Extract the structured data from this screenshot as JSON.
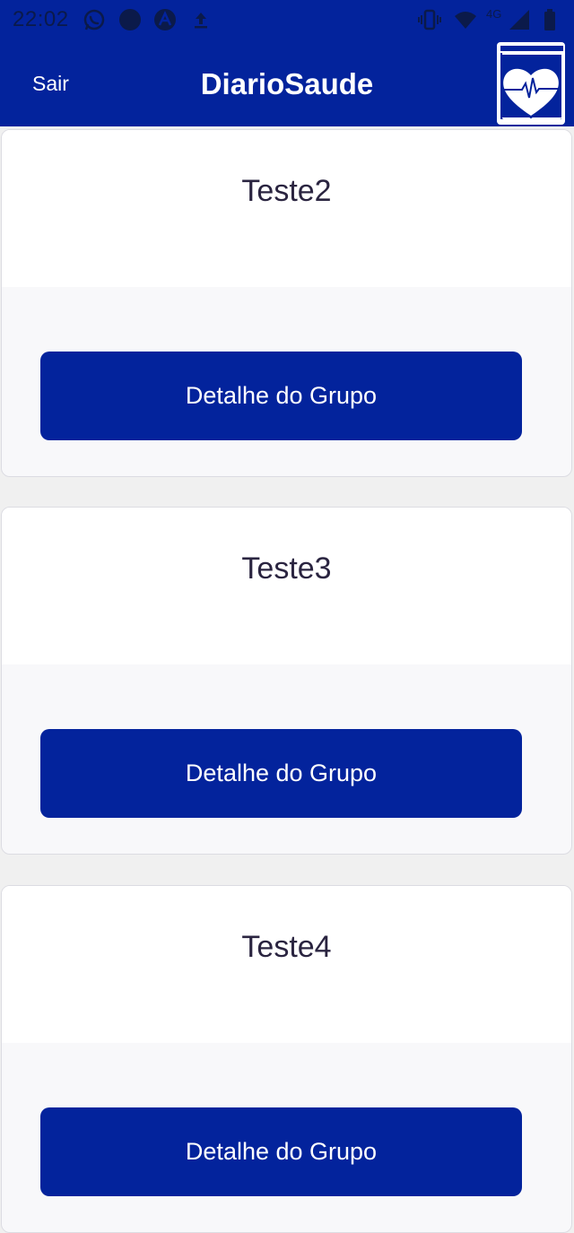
{
  "status_bar": {
    "time": "22:02",
    "network": "4G",
    "icons": [
      "whatsapp-icon",
      "circle-notification-icon",
      "app-a-icon",
      "upload-icon",
      "vibrate-icon",
      "wifi-icon",
      "signal-icon",
      "battery-icon"
    ]
  },
  "app_bar": {
    "back_label": "Sair",
    "title": "DiarioSaude",
    "logo": "heart-book-logo"
  },
  "groups": [
    {
      "name": "Teste2",
      "button_label": "Detalhe do Grupo"
    },
    {
      "name": "Teste3",
      "button_label": "Detalhe do Grupo"
    },
    {
      "name": "Teste4",
      "button_label": "Detalhe do Grupo"
    }
  ],
  "colors": {
    "primary": "#03239c",
    "background": "#f0f0f0",
    "card_header": "#ffffff",
    "card_body": "#f8f8fa",
    "title_text": "#2a2440"
  }
}
